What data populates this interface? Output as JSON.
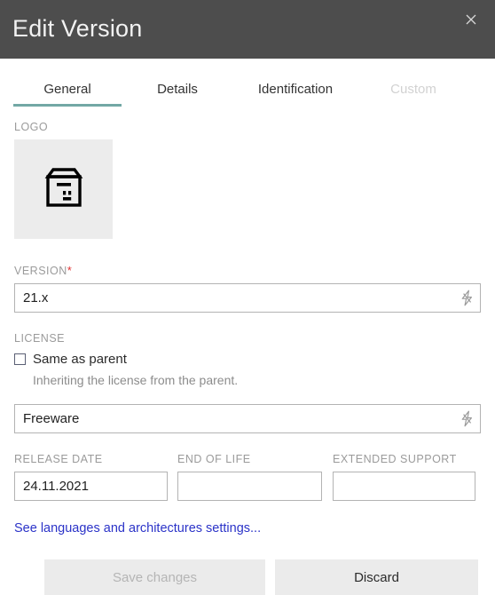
{
  "window": {
    "title": "Edit Version",
    "close_icon": "close-icon",
    "header_bg": "#4d4d4d"
  },
  "tabs": {
    "accent_color": "#73a8a5",
    "items": [
      {
        "label": "General",
        "state": "active"
      },
      {
        "label": "Details",
        "state": "enabled"
      },
      {
        "label": "Identification",
        "state": "enabled"
      },
      {
        "label": "Custom",
        "state": "disabled"
      }
    ]
  },
  "form": {
    "logo": {
      "label": "LOGO",
      "icon": "box-package-icon",
      "box_bg": "#ececec"
    },
    "version": {
      "label": "VERSION",
      "required_marker": "*",
      "required_color": "#e03131",
      "value": "21.x",
      "action_icon": "lightning-bolt-icon"
    },
    "license": {
      "label": "LICENSE",
      "same_as_parent_label": "Same as parent",
      "same_as_parent_checked": false,
      "hint": "Inheriting the license from the parent.",
      "value": "Freeware",
      "action_icon": "lightning-bolt-icon"
    },
    "dates": [
      {
        "label": "RELEASE DATE",
        "value": "24.11.2021"
      },
      {
        "label": "END OF LIFE",
        "value": ""
      },
      {
        "label": "EXTENDED SUPPORT",
        "value": ""
      }
    ],
    "settings_link": {
      "label": "See languages and architectures settings...",
      "color": "#2b33c8"
    }
  },
  "footer": {
    "save_label": "Save changes",
    "save_enabled": false,
    "discard_label": "Discard"
  }
}
